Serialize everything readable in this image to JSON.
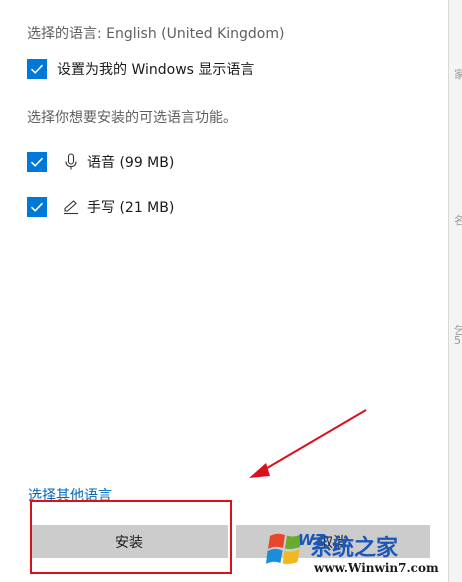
{
  "dialog": {
    "selected_language": "选择的语言: English (United Kingdom)",
    "set_display_language": {
      "label": "设置为我的 Windows 显示语言",
      "checked": true
    },
    "optional_features_prompt": "选择你想要安装的可选语言功能。",
    "features": [
      {
        "label": "语音 (99 MB)",
        "checked": true,
        "icon": "microphone-icon"
      },
      {
        "label": "手写 (21 MB)",
        "checked": true,
        "icon": "pen-icon"
      }
    ],
    "other_languages_link": "选择其他语言",
    "install_button": "安装",
    "cancel_button": "取消"
  },
  "side_edge": {
    "glyphs": [
      "家",
      "名",
      "乞",
      "5"
    ]
  },
  "watermark": {
    "brand": "系统之家",
    "url": "www.Winwin7.com",
    "logo_letters": "W7"
  },
  "colors": {
    "accent": "#0078d7",
    "link": "#0067b8",
    "button": "#cccccc",
    "annotation_red": "#d9111b"
  }
}
